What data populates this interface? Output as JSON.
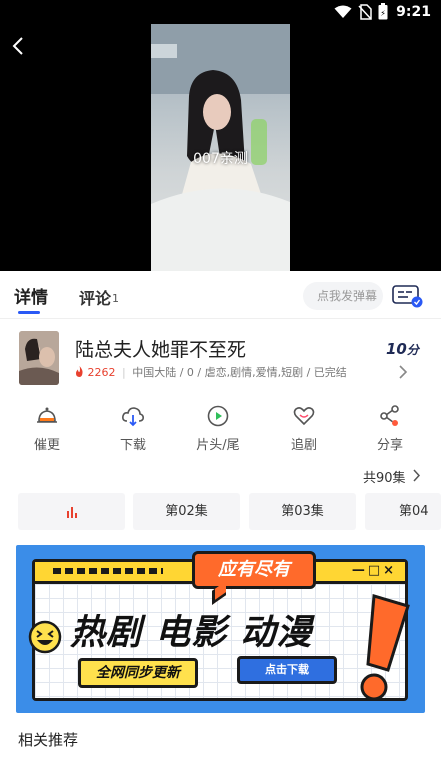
{
  "status_bar": {
    "time": "9:21"
  },
  "video": {
    "caption": "007亲测"
  },
  "tabs": {
    "detail_label": "详情",
    "comments_label": "评论",
    "comments_count": "1",
    "danmaku_placeholder": "点我发弹幕"
  },
  "drama": {
    "title": "陆总夫人她罪不至死",
    "score": "10",
    "score_unit": "分",
    "heat": "2262",
    "meta": "中国大陆 / 0 / 虐恋,剧情,爱情,短剧 / 已完结"
  },
  "actions": [
    {
      "label": "催更",
      "icon": "bell-icon"
    },
    {
      "label": "下载",
      "icon": "cloud-download-icon"
    },
    {
      "label": "片头/尾",
      "icon": "play-circle-icon"
    },
    {
      "label": "追剧",
      "icon": "heart-icon"
    },
    {
      "label": "分享",
      "icon": "share-icon"
    }
  ],
  "episodes": {
    "total_label": "共90集",
    "items": [
      "",
      "第02集",
      "第03集",
      "第04"
    ]
  },
  "banner": {
    "bubble": "应有尽有",
    "headline": "热剧 电影 动漫",
    "sync_label": "全网同步更新",
    "download_label": "点击下载",
    "window_controls": "—□×"
  },
  "related": {
    "title": "相关推荐"
  },
  "colors": {
    "accent": "#2a59f5",
    "heat": "#e8412f",
    "banner_bg": "#3b8de8",
    "banner_yellow": "#ffd633",
    "banner_orange": "#ff6a2b",
    "playing": "#e8412f"
  }
}
